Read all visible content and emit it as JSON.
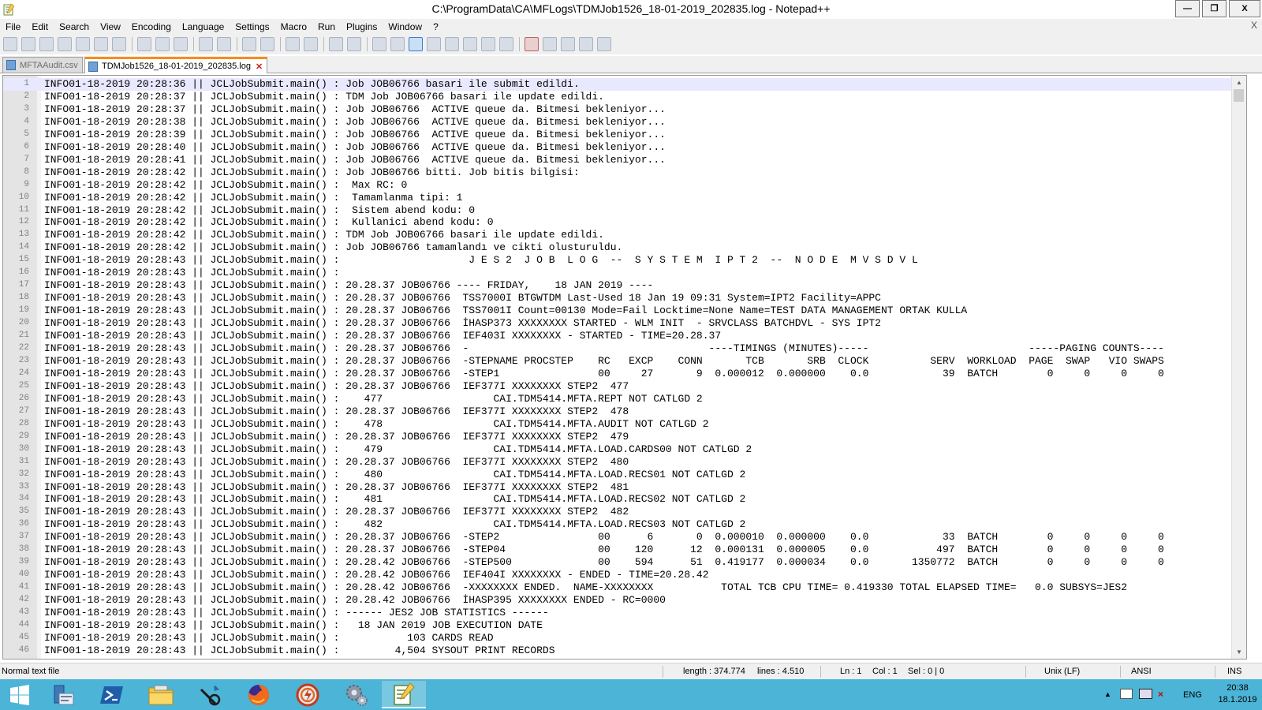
{
  "window": {
    "title": "C:\\ProgramData\\CA\\MFLogs\\TDMJob1526_18-01-2019_202835.log - Notepad++",
    "controls": {
      "minimize": "—",
      "maximize": "❐",
      "close": "X"
    }
  },
  "menu": {
    "items": [
      "File",
      "Edit",
      "Search",
      "View",
      "Encoding",
      "Language",
      "Settings",
      "Macro",
      "Run",
      "Plugins",
      "Window",
      "?"
    ],
    "close_label": "X"
  },
  "toolbar": {
    "icons": [
      "new-file-icon",
      "open-file-icon",
      "save-icon",
      "save-all-icon",
      "close-icon",
      "close-all-icon",
      "print-icon",
      "cut-icon",
      "copy-icon",
      "paste-icon",
      "undo-icon",
      "redo-icon",
      "find-icon",
      "replace-icon",
      "zoom-in-icon",
      "zoom-out-icon",
      "sync-vertical-icon",
      "sync-horizontal-icon",
      "word-wrap-icon",
      "show-all-chars-icon",
      "indent-guide-icon",
      "udl-icon",
      "document-map-icon",
      "function-list-icon",
      "folder-workspace-icon",
      "monitor-icon",
      "record-macro-icon",
      "stop-macro-icon",
      "play-macro-icon",
      "run-multiple-macro-icon",
      "save-macro-icon"
    ]
  },
  "tabs": [
    {
      "label": "MFTAAudit.csv",
      "active": false
    },
    {
      "label": "TDMJob1526_18-01-2019_202835.log",
      "active": true
    }
  ],
  "editor": {
    "current_line": 1,
    "lines": [
      "INFO01-18-2019 20:28:36 || JCLJobSubmit.main() : Job JOB06766 basari ile submit edildi.",
      "INFO01-18-2019 20:28:37 || JCLJobSubmit.main() : TDM Job JOB06766 basari ile update edildi.",
      "INFO01-18-2019 20:28:37 || JCLJobSubmit.main() : Job JOB06766  ACTIVE queue da. Bitmesi bekleniyor...",
      "INFO01-18-2019 20:28:38 || JCLJobSubmit.main() : Job JOB06766  ACTIVE queue da. Bitmesi bekleniyor...",
      "INFO01-18-2019 20:28:39 || JCLJobSubmit.main() : Job JOB06766  ACTIVE queue da. Bitmesi bekleniyor...",
      "INFO01-18-2019 20:28:40 || JCLJobSubmit.main() : Job JOB06766  ACTIVE queue da. Bitmesi bekleniyor...",
      "INFO01-18-2019 20:28:41 || JCLJobSubmit.main() : Job JOB06766  ACTIVE queue da. Bitmesi bekleniyor...",
      "INFO01-18-2019 20:28:42 || JCLJobSubmit.main() : Job JOB06766 bitti. Job bitis bilgisi:",
      "INFO01-18-2019 20:28:42 || JCLJobSubmit.main() :  Max RC: 0",
      "INFO01-18-2019 20:28:42 || JCLJobSubmit.main() :  Tamamlanma tipi: 1",
      "INFO01-18-2019 20:28:42 || JCLJobSubmit.main() :  Sistem abend kodu: 0",
      "INFO01-18-2019 20:28:42 || JCLJobSubmit.main() :  Kullanici abend kodu: 0",
      "INFO01-18-2019 20:28:42 || JCLJobSubmit.main() : TDM Job JOB06766 basari ile update edildi.",
      "INFO01-18-2019 20:28:42 || JCLJobSubmit.main() : Job JOB06766 tamamlandı ve cikti olusturuldu.",
      "INFO01-18-2019 20:28:43 || JCLJobSubmit.main() :                     J E S 2  J O B  L O G  --  S Y S T E M  I P T 2  --  N O D E  M V S D V L",
      "INFO01-18-2019 20:28:43 || JCLJobSubmit.main() :",
      "INFO01-18-2019 20:28:43 || JCLJobSubmit.main() : 20.28.37 JOB06766 ---- FRIDAY,    18 JAN 2019 ----",
      "INFO01-18-2019 20:28:43 || JCLJobSubmit.main() : 20.28.37 JOB06766  TSS7000I BTGWTDM Last-Used 18 Jan 19 09:31 System=IPT2 Facility=APPC",
      "INFO01-18-2019 20:28:43 || JCLJobSubmit.main() : 20.28.37 JOB06766  TSS7001I Count=00130 Mode=Fail Locktime=None Name=TEST DATA MANAGEMENT ORTAK KULLA",
      "INFO01-18-2019 20:28:43 || JCLJobSubmit.main() : 20.28.37 JOB06766  İHASP373 XXXXXXXX STARTED - WLM INIT  - SRVCLASS BATCHDVL - SYS IPT2",
      "INFO01-18-2019 20:28:43 || JCLJobSubmit.main() : 20.28.37 JOB06766  IEF403I XXXXXXXX - STARTED - TIME=20.28.37",
      "INFO01-18-2019 20:28:43 || JCLJobSubmit.main() : 20.28.37 JOB06766  -                                       ----TIMINGS (MINUTES)-----                          -----PAGING COUNTS----",
      "INFO01-18-2019 20:28:43 || JCLJobSubmit.main() : 20.28.37 JOB06766  -STEPNAME PROCSTEP    RC   EXCP    CONN       TCB       SRB  CLOCK          SERV  WORKLOAD  PAGE  SWAP   VIO SWAPS",
      "INFO01-18-2019 20:28:43 || JCLJobSubmit.main() : 20.28.37 JOB06766  -STEP1                00     27       9  0.000012  0.000000    0.0            39  BATCH        0     0     0     0",
      "INFO01-18-2019 20:28:43 || JCLJobSubmit.main() : 20.28.37 JOB06766  IEF377I XXXXXXXX STEP2  477",
      "INFO01-18-2019 20:28:43 || JCLJobSubmit.main() :    477                  CAI.TDM5414.MFTA.REPT NOT CATLGD 2",
      "INFO01-18-2019 20:28:43 || JCLJobSubmit.main() : 20.28.37 JOB06766  IEF377I XXXXXXXX STEP2  478",
      "INFO01-18-2019 20:28:43 || JCLJobSubmit.main() :    478                  CAI.TDM5414.MFTA.AUDIT NOT CATLGD 2",
      "INFO01-18-2019 20:28:43 || JCLJobSubmit.main() : 20.28.37 JOB06766  IEF377I XXXXXXXX STEP2  479",
      "INFO01-18-2019 20:28:43 || JCLJobSubmit.main() :    479                  CAI.TDM5414.MFTA.LOAD.CARDS00 NOT CATLGD 2",
      "INFO01-18-2019 20:28:43 || JCLJobSubmit.main() : 20.28.37 JOB06766  IEF377I XXXXXXXX STEP2  480",
      "INFO01-18-2019 20:28:43 || JCLJobSubmit.main() :    480                  CAI.TDM5414.MFTA.LOAD.RECS01 NOT CATLGD 2",
      "INFO01-18-2019 20:28:43 || JCLJobSubmit.main() : 20.28.37 JOB06766  IEF377I XXXXXXXX STEP2  481",
      "INFO01-18-2019 20:28:43 || JCLJobSubmit.main() :    481                  CAI.TDM5414.MFTA.LOAD.RECS02 NOT CATLGD 2",
      "INFO01-18-2019 20:28:43 || JCLJobSubmit.main() : 20.28.37 JOB06766  IEF377I XXXXXXXX STEP2  482",
      "INFO01-18-2019 20:28:43 || JCLJobSubmit.main() :    482                  CAI.TDM5414.MFTA.LOAD.RECS03 NOT CATLGD 2",
      "INFO01-18-2019 20:28:43 || JCLJobSubmit.main() : 20.28.37 JOB06766  -STEP2                00      6       0  0.000010  0.000000    0.0            33  BATCH        0     0     0     0",
      "INFO01-18-2019 20:28:43 || JCLJobSubmit.main() : 20.28.37 JOB06766  -STEP04               00    120      12  0.000131  0.000005    0.0           497  BATCH        0     0     0     0",
      "INFO01-18-2019 20:28:43 || JCLJobSubmit.main() : 20.28.42 JOB06766  -STEP500              00    594      51  0.419177  0.000034    0.0       1350772  BATCH        0     0     0     0",
      "INFO01-18-2019 20:28:43 || JCLJobSubmit.main() : 20.28.42 JOB06766  IEF404I XXXXXXXX - ENDED - TIME=20.28.42",
      "INFO01-18-2019 20:28:43 || JCLJobSubmit.main() : 20.28.42 JOB06766  -XXXXXXXX ENDED.  NAME-XXXXXXXX           TOTAL TCB CPU TIME= 0.419330 TOTAL ELAPSED TIME=   0.0 SUBSYS=JES2",
      "INFO01-18-2019 20:28:43 || JCLJobSubmit.main() : 20.28.42 JOB06766  İHASP395 XXXXXXXX ENDED - RC=0000",
      "INFO01-18-2019 20:28:43 || JCLJobSubmit.main() : ------ JES2 JOB STATISTICS ------",
      "INFO01-18-2019 20:28:43 || JCLJobSubmit.main() :   18 JAN 2019 JOB EXECUTION DATE",
      "INFO01-18-2019 20:28:43 || JCLJobSubmit.main() :           103 CARDS READ",
      "INFO01-18-2019 20:28:43 || JCLJobSubmit.main() :         4,504 SYSOUT PRINT RECORDS"
    ]
  },
  "status": {
    "file_type": "Normal text file",
    "length": "length : 374.774",
    "lines": "lines : 4.510",
    "ln": "Ln : 1",
    "col": "Col : 1",
    "sel": "Sel : 0 | 0",
    "eol": "Unix (LF)",
    "encoding": "ANSI",
    "mode": "INS"
  },
  "taskbar": {
    "apps": [
      "start-icon",
      "server-manager-icon",
      "powershell-icon",
      "file-explorer-icon",
      "tool-icon",
      "firefox-icon",
      "app-icon",
      "settings-icon",
      "notepad-plus-plus-icon"
    ],
    "language": "ENG",
    "time": "20:38",
    "date": "18.1.2019"
  }
}
